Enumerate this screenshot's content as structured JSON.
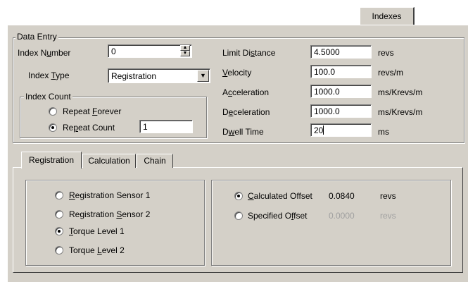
{
  "tabs_top": {
    "indexes": "Indexes"
  },
  "data_entry": {
    "legend": "Data Entry",
    "index_number": {
      "label_pre": "Index N",
      "label_u": "u",
      "label_post": "mber",
      "value": "0"
    },
    "index_type": {
      "label_pre": "Index ",
      "label_u": "T",
      "label_post": "ype",
      "value": "Registration"
    },
    "index_count": {
      "legend": "Index Count",
      "repeat_forever": {
        "pre": "Repeat ",
        "u": "F",
        "post": "orever",
        "selected": false
      },
      "repeat_count": {
        "pre": "Re",
        "u": "p",
        "post": "eat Count",
        "selected": true,
        "value": "1"
      }
    },
    "limit_distance": {
      "pre": "Limit Di",
      "u": "s",
      "post": "tance",
      "value": "4.5000",
      "unit": "revs"
    },
    "velocity": {
      "pre": "",
      "u": "V",
      "post": "elocity",
      "value": "100.0",
      "unit": "revs/m"
    },
    "acceleration": {
      "pre": "A",
      "u": "c",
      "post": "celeration",
      "value": "1000.0",
      "unit": "ms/Krevs/m"
    },
    "deceleration": {
      "pre": "D",
      "u": "e",
      "post": "celeration",
      "value": "1000.0",
      "unit": "ms/Krevs/m"
    },
    "dwell_time": {
      "pre": "D",
      "u": "w",
      "post": "ell Time",
      "value": "20",
      "unit": "ms"
    }
  },
  "tabs_bottom": [
    "Registration",
    "Calculation",
    "Chain"
  ],
  "registration": {
    "sensor1": {
      "pre": "",
      "u": "R",
      "post": "egistration Sensor 1",
      "selected": false
    },
    "sensor2": {
      "pre": "Registration ",
      "u": "S",
      "post": "ensor 2",
      "selected": false
    },
    "torque1": {
      "pre": "",
      "u": "T",
      "post": "orque Level 1",
      "selected": true
    },
    "torque2": {
      "pre": "Torque ",
      "u": "L",
      "post": "evel 2",
      "selected": false
    }
  },
  "offset": {
    "calculated": {
      "pre": "",
      "u": "C",
      "post": "alculated Offset",
      "value": "0.0840",
      "unit": "revs",
      "selected": true
    },
    "specified": {
      "pre": "Specified O",
      "u": "f",
      "post": "fset",
      "value": "0.0000",
      "unit": "revs",
      "selected": false
    }
  },
  "colors": {
    "panel": "#d4d0c8",
    "shadow": "#808080",
    "highlight": "#ffffff"
  }
}
